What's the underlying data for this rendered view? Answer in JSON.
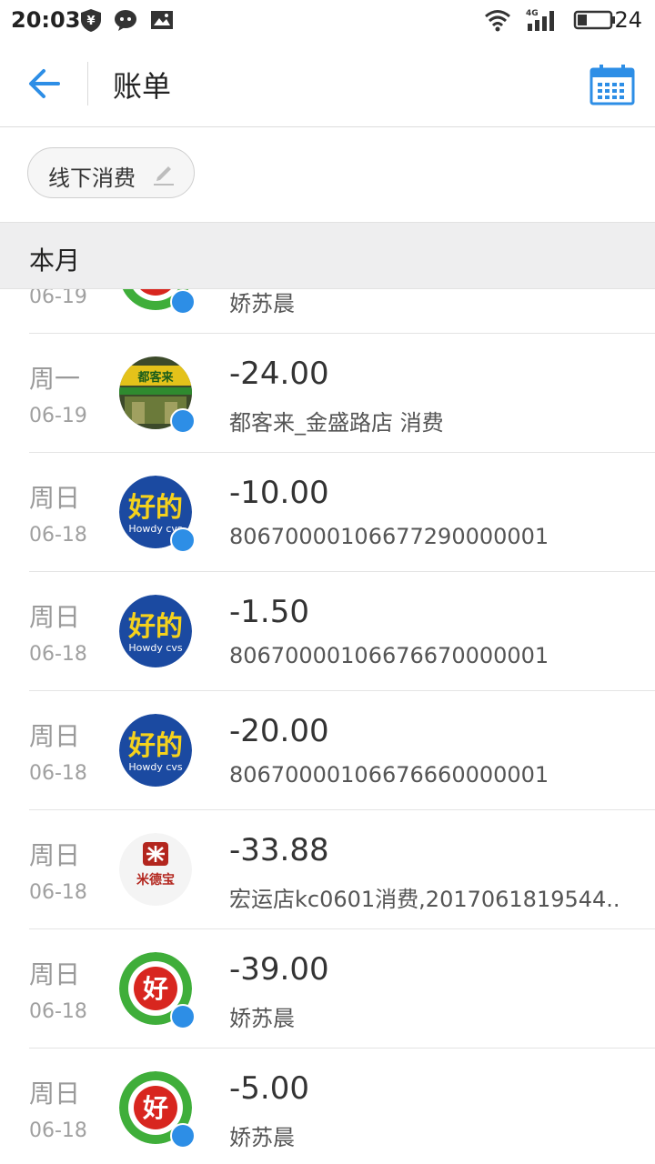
{
  "status_bar": {
    "time": "20:03",
    "battery": "24",
    "network": "4G",
    "icons": [
      "yen-shield-icon",
      "chat-bubble-icon",
      "image-icon",
      "wifi-icon",
      "signal-icon",
      "battery-icon"
    ]
  },
  "header": {
    "title": "账单",
    "back_icon": "back-arrow-icon",
    "calendar_icon": "calendar-icon",
    "accent_color": "#2d8ee6"
  },
  "filter": {
    "label": "线下消费",
    "icon": "edit-pencil-icon"
  },
  "month": {
    "label": "本月"
  },
  "transactions": [
    {
      "day": "",
      "date": "06-19",
      "amount": "",
      "desc": "娇苏晨",
      "logo": "haoyouduo-logo"
    },
    {
      "day": "周一",
      "date": "06-19",
      "amount": "-24.00",
      "desc": "都客来_金盛路店 消费",
      "logo": "doukelai-storefront"
    },
    {
      "day": "周日",
      "date": "06-18",
      "amount": "-10.00",
      "desc": "80670000106677290000001",
      "logo": "howdy-logo"
    },
    {
      "day": "周日",
      "date": "06-18",
      "amount": "-1.50",
      "desc": "80670000106676670000001",
      "logo": "howdy-logo"
    },
    {
      "day": "周日",
      "date": "06-18",
      "amount": "-20.00",
      "desc": "80670000106676660000001",
      "logo": "howdy-logo"
    },
    {
      "day": "周日",
      "date": "06-18",
      "amount": "-33.88",
      "desc": "宏运店kc0601消费,2017061819544..",
      "logo": "midebao-logo"
    },
    {
      "day": "周日",
      "date": "06-18",
      "amount": "-39.00",
      "desc": "娇苏晨",
      "logo": "haoyouduo-logo"
    },
    {
      "day": "周日",
      "date": "06-18",
      "amount": "-5.00",
      "desc": "娇苏晨",
      "logo": "haoyouduo-logo"
    }
  ],
  "logo_texts": {
    "howdy_main": "好的",
    "howdy_sub": "Howdy cvs",
    "midebao": "米德宝",
    "haoyouduo": "好",
    "doukelai": "都客来"
  }
}
